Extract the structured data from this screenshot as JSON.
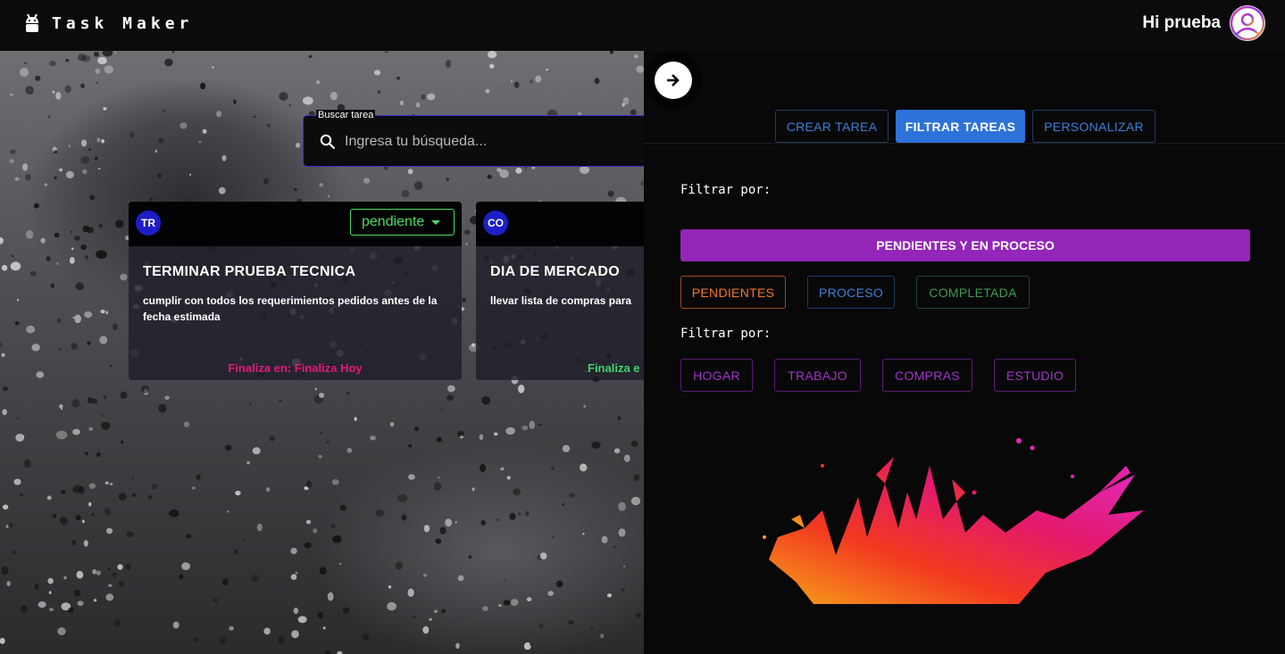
{
  "header": {
    "app_title": "Task Maker",
    "greeting": "Hi prueba"
  },
  "search": {
    "label": "Buscar tarea",
    "placeholder": "Ingresa tu búsqueda..."
  },
  "cards": [
    {
      "initials": "TR",
      "status": "pendiente",
      "title": "TERMINAR PRUEBA TECNICA",
      "description": "cumplir con todos los requerimientos pedidos antes de la fecha estimada",
      "due": "Finaliza en: Finaliza Hoy",
      "due_color": "#e3197c"
    },
    {
      "initials": "CO",
      "title": "DIA DE MERCADO",
      "description": "llevar lista de compras para",
      "due": "Finaliza e",
      "due_color": "#3fd36f"
    }
  ],
  "panel": {
    "tabs": [
      {
        "label": "CREAR TAREA",
        "active": false
      },
      {
        "label": "FILTRAR TAREAS",
        "active": true
      },
      {
        "label": "PERSONALIZAR",
        "active": false
      }
    ],
    "filter_label_1": "Filtrar por:",
    "primary_filter": "PENDIENTES Y EN PROCESO",
    "status_filters": [
      "PENDIENTES",
      "PROCESO",
      "COMPLETADA"
    ],
    "filter_label_2": "Filtrar por:",
    "category_filters": [
      "HOGAR",
      "TRABAJO",
      "COMPRAS",
      "ESTUDIO"
    ]
  },
  "colors": {
    "accent_blue": "#2d72d9",
    "accent_purple": "#9326b8",
    "status_green": "#4cd964",
    "badge_blue": "#1e1ec8"
  },
  "icons": {
    "logo": "android-icon",
    "search": "search-icon",
    "toggle": "arrow-right-icon",
    "avatar": "user-avatar-icon"
  }
}
